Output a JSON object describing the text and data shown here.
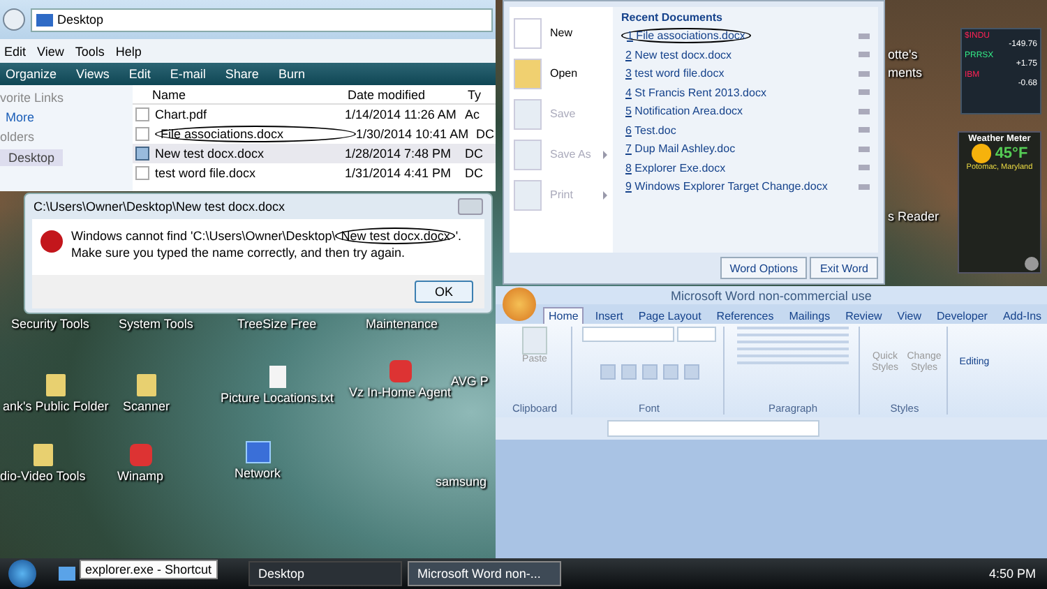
{
  "explorer": {
    "address": "Desktop",
    "menu": [
      "Edit",
      "View",
      "Tools",
      "Help"
    ],
    "toolbar": [
      "Organize",
      "Views",
      "Edit",
      "E-mail",
      "Share",
      "Burn"
    ],
    "sidebar": [
      {
        "label": "vorite Links",
        "kind": "heading",
        "selected": false
      },
      {
        "label": "More",
        "kind": "link",
        "selected": false
      },
      {
        "label": "olders",
        "kind": "heading",
        "selected": false
      },
      {
        "label": "Desktop",
        "kind": "folder",
        "selected": true
      }
    ],
    "columns": [
      "Name",
      "Date modified",
      "Ty"
    ],
    "rows": [
      {
        "name": "Chart.pdf",
        "date": "1/14/2014 11:26 AM",
        "type": "Ac",
        "selected": false,
        "checked": false,
        "circled": false
      },
      {
        "name": "File associations.docx",
        "date": "1/30/2014 10:41 AM",
        "type": "DC",
        "selected": false,
        "checked": false,
        "circled": true
      },
      {
        "name": "New test docx.docx",
        "date": "1/28/2014 7:48 PM",
        "type": "DC",
        "selected": true,
        "checked": true,
        "circled": false
      },
      {
        "name": "test word file.docx",
        "date": "1/31/2014 4:41 PM",
        "type": "DC",
        "selected": false,
        "checked": false,
        "circled": false
      }
    ]
  },
  "error_dialog": {
    "title": "C:\\Users\\Owner\\Desktop\\New test docx.docx",
    "message_before": "Windows cannot find 'C:\\Users\\Owner\\Desktop\\",
    "message_circled": "New test docx.docx",
    "message_after": "'. Make sure you typed the name correctly, and then try again.",
    "button": "OK"
  },
  "office_menu": {
    "commands": [
      {
        "label": "New",
        "disabled": false,
        "submenu": false
      },
      {
        "label": "Open",
        "disabled": false,
        "submenu": false
      },
      {
        "label": "Save",
        "disabled": true,
        "submenu": false
      },
      {
        "label": "Save As",
        "disabled": true,
        "submenu": true
      },
      {
        "label": "Print",
        "disabled": true,
        "submenu": true
      }
    ],
    "recent_title": "Recent Documents",
    "recent": [
      {
        "number": "1",
        "name": "File associations.docx",
        "circled": true
      },
      {
        "number": "2",
        "name": "New test docx.docx",
        "circled": false
      },
      {
        "number": "3",
        "name": "test word file.docx",
        "circled": false
      },
      {
        "number": "4",
        "name": "St Francis Rent 2013.docx",
        "circled": false
      },
      {
        "number": "5",
        "name": "Notification Area.docx",
        "circled": false
      },
      {
        "number": "6",
        "name": "Test.doc",
        "circled": false
      },
      {
        "number": "7",
        "name": "Dup Mail Ashley.doc",
        "circled": false
      },
      {
        "number": "8",
        "name": "Explorer Exe.docx",
        "circled": false
      },
      {
        "number": "9",
        "name": "Windows Explorer Target Change.docx",
        "circled": false
      }
    ],
    "buttons": [
      "Word Options",
      "Exit Word"
    ]
  },
  "word": {
    "title": "Microsoft Word non-commercial use",
    "tabs": [
      {
        "label": "Home",
        "selected": true
      },
      {
        "label": "Insert",
        "selected": false
      },
      {
        "label": "Page Layout",
        "selected": false
      },
      {
        "label": "References",
        "selected": false
      },
      {
        "label": "Mailings",
        "selected": false
      },
      {
        "label": "Review",
        "selected": false
      },
      {
        "label": "View",
        "selected": false
      },
      {
        "label": "Developer",
        "selected": false
      },
      {
        "label": "Add-Ins",
        "selected": false
      }
    ],
    "paste": "Paste",
    "quick_styles": "Quick Styles",
    "change_styles": "Change Styles",
    "editing": "Editing",
    "groups": [
      "Clipboard",
      "Font",
      "Paragraph",
      "Styles"
    ]
  },
  "gadgets": {
    "stocks": [
      {
        "symbol": "$INDU",
        "change": "-149.76",
        "up": false
      },
      {
        "symbol": "PRRSX",
        "change": "+1.75",
        "up": true
      },
      {
        "symbol": "IBM",
        "change": "-0.68",
        "up": false
      }
    ],
    "weather_title": "Weather Meter",
    "temperature": "45°F",
    "location": "Potomac, Maryland"
  },
  "desktop_icons": [
    {
      "label": "Security Tools",
      "kind": "label"
    },
    {
      "label": "System Tools",
      "kind": "label"
    },
    {
      "label": "TreeSize Free",
      "kind": "label"
    },
    {
      "label": "Maintenance",
      "kind": "label"
    },
    {
      "label": "ank's Public Folder",
      "kind": "folder"
    },
    {
      "label": "Scanner",
      "kind": "folder"
    },
    {
      "label": "Picture Locations.txt",
      "kind": "file"
    },
    {
      "label": "Vz  In-Home Agent",
      "kind": "app"
    },
    {
      "label": "AVG P",
      "kind": "label"
    },
    {
      "label": "dio-Video Tools",
      "kind": "folder"
    },
    {
      "label": "Winamp",
      "kind": "app"
    },
    {
      "label": "Network",
      "kind": "network"
    },
    {
      "label": "samsung",
      "kind": "label"
    },
    {
      "label": "otte's",
      "kind": "label"
    },
    {
      "label": "ments",
      "kind": "label"
    },
    {
      "label": "s Reader",
      "kind": "label"
    }
  ],
  "taskbar": {
    "tooltip": "explorer.exe - Shortcut",
    "items": [
      {
        "label": "Desktop",
        "selected": false
      },
      {
        "label": "Microsoft Word non-...",
        "selected": true
      }
    ],
    "clock": "4:50 PM"
  }
}
